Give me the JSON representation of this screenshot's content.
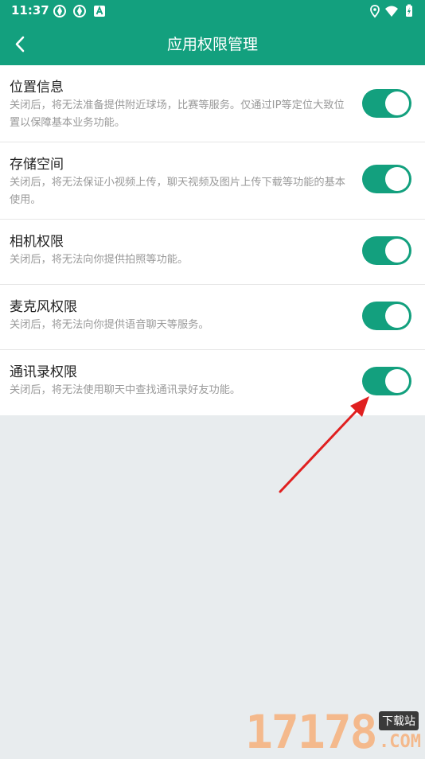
{
  "status_bar": {
    "time": "11:37"
  },
  "header": {
    "title": "应用权限管理"
  },
  "permissions": [
    {
      "title": "位置信息",
      "description": "关闭后，将无法准备提供附近球场，比赛等服务。仅通过IP等定位大致位置以保障基本业务功能。",
      "enabled": true
    },
    {
      "title": "存储空间",
      "description": "关闭后，将无法保证小视频上传，聊天视频及图片上传下载等功能的基本使用。",
      "enabled": true
    },
    {
      "title": "相机权限",
      "description": "关闭后，将无法向你提供拍照等功能。",
      "enabled": true
    },
    {
      "title": "麦克风权限",
      "description": "关闭后，将无法向你提供语音聊天等服务。",
      "enabled": true
    },
    {
      "title": "通讯录权限",
      "description": "关闭后，将无法使用聊天中查找通讯录好友功能。",
      "enabled": true
    }
  ],
  "watermark": {
    "number": "17178",
    "badge": "下载站",
    "suffix": ".COM"
  },
  "colors": {
    "primary": "#13a07e",
    "background": "#e8ecee",
    "arrow": "#e02020"
  }
}
